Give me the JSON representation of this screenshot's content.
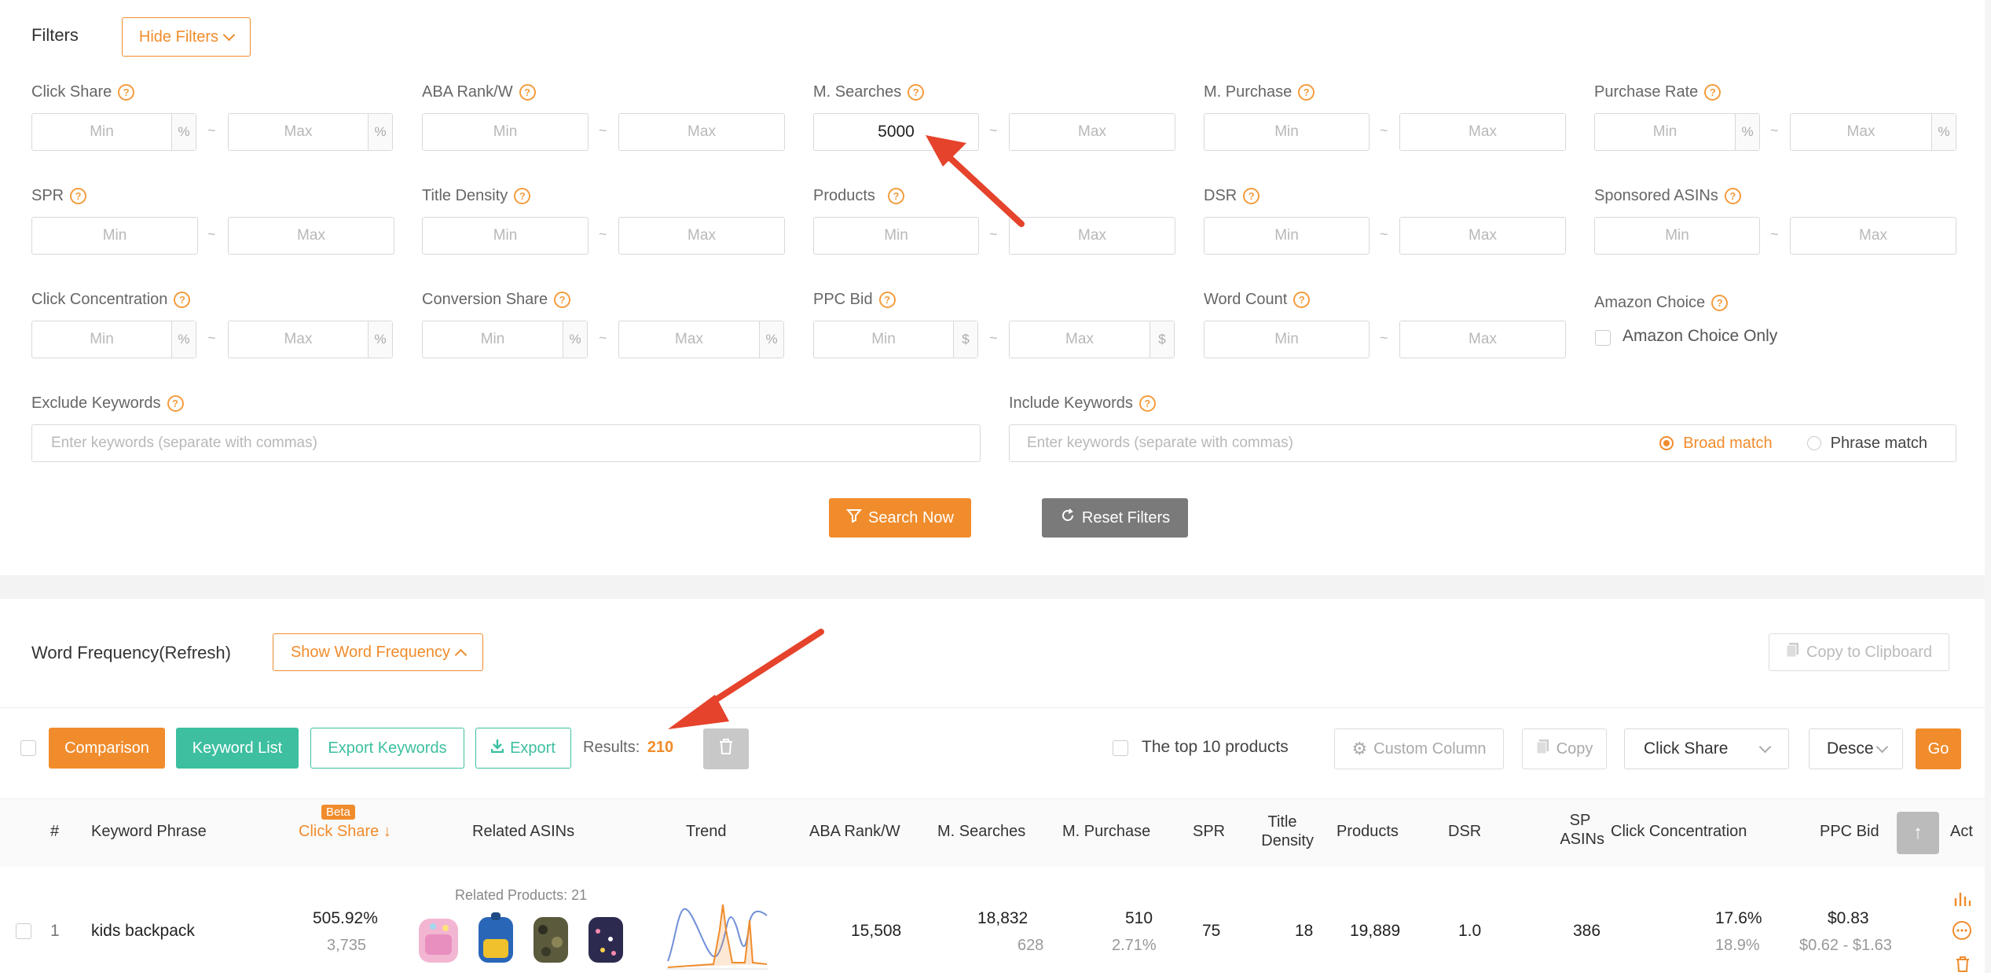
{
  "filters": {
    "title": "Filters",
    "hide_filters_label": "Hide Filters",
    "click_share": "Click Share",
    "aba_rank": "ABA Rank/W",
    "m_searches": "M. Searches",
    "m_searches_min_value": "5000",
    "m_purchase": "M. Purchase",
    "purchase_rate": "Purchase Rate",
    "spr": "SPR",
    "title_density": "Title Density",
    "products": "Products",
    "dsr": "DSR",
    "sponsored_asins": "Sponsored ASINs",
    "click_concentration": "Click Concentration",
    "conversion_share": "Conversion Share",
    "ppc_bid": "PPC Bid",
    "word_count": "Word Count",
    "amazon_choice": "Amazon Choice",
    "amazon_choice_only": "Amazon Choice Only",
    "exclude_keywords": "Exclude Keywords",
    "include_keywords": "Include Keywords",
    "keywords_placeholder": "Enter keywords (separate with commas)",
    "broad_match": "Broad match",
    "phrase_match": "Phrase match",
    "min_placeholder": "Min",
    "max_placeholder": "Max",
    "percent": "%",
    "dollar": "$",
    "tilde": "~",
    "search_now": "Search Now",
    "reset_filters": "Reset Filters"
  },
  "word_frequency": {
    "title": "Word Frequency(Refresh)",
    "show_label": "Show Word Frequency",
    "copy_clipboard": "Copy to Clipboard"
  },
  "toolbar": {
    "comparison": "Comparison",
    "keyword_list": "Keyword List",
    "export_keywords": "Export Keywords",
    "export": "Export",
    "results_label": "Results:",
    "results_count": "210",
    "top10": "The top 10 products",
    "custom_column": "Custom Column",
    "copy": "Copy",
    "sort_field": "Click Share",
    "sort_order": "Desce",
    "go": "Go"
  },
  "table": {
    "headers": {
      "num": "#",
      "keyword": "Keyword Phrase",
      "beta": "Beta",
      "click_share": "Click Share",
      "related_asins": "Related ASINs",
      "trend": "Trend",
      "aba_rank": "ABA Rank/W",
      "m_searches": "M. Searches",
      "m_purchase": "M. Purchase",
      "spr": "SPR",
      "title_density_1": "Title",
      "title_density_2": "Density",
      "products": "Products",
      "dsr": "DSR",
      "sp_asins_1": "SP",
      "sp_asins_2": "ASINs",
      "click_concentration": "Click Concentration",
      "ppc_bid": "PPC Bid",
      "actions": "Act"
    },
    "rows": [
      {
        "index": "1",
        "keyword": "kids backpack",
        "click_share": "505.92%",
        "click_share_sub": "3,735",
        "related_products": "Related Products: 21",
        "aba_rank": "15,508",
        "m_searches": "18,832",
        "m_searches_sub": "628",
        "m_purchase": "510",
        "m_purchase_sub": "2.71%",
        "spr": "75",
        "title_density": "18",
        "products": "19,889",
        "dsr": "1.0",
        "sp_asins": "386",
        "click_concentration": "17.6%",
        "click_concentration_sub": "18.9%",
        "ppc_bid": "$0.83",
        "ppc_bid_range": "$0.62 - $1.63"
      }
    ]
  },
  "colors": {
    "accent": "#f08c2c",
    "teal": "#3dbfa0",
    "gray_button": "#7a7a7a",
    "arrow": "#e5432b"
  },
  "icons": [
    "chevron-down-icon",
    "chevron-up-icon",
    "filter-icon",
    "refresh-icon",
    "clipboard-icon",
    "download-icon",
    "trash-icon",
    "gear-icon",
    "copy-icon",
    "arrow-up-icon",
    "bar-chart-icon",
    "more-icon",
    "help-icon",
    "sort-down-icon"
  ]
}
